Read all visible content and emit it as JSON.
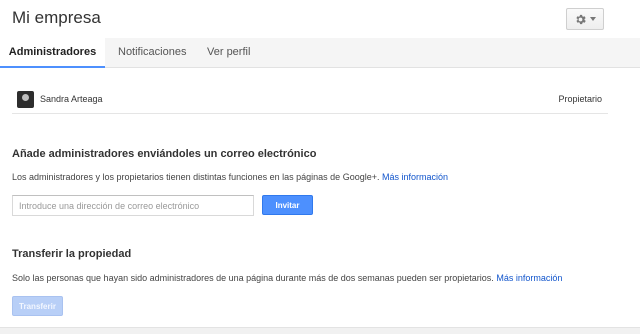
{
  "header": {
    "title": "Mi empresa",
    "settings_icon": "gear-icon",
    "dropdown_icon": "caret-down-icon"
  },
  "tabs": [
    {
      "label": "Administradores",
      "active": true
    },
    {
      "label": "Notificaciones",
      "active": false
    },
    {
      "label": "Ver perfil",
      "active": false
    }
  ],
  "owner": {
    "name": "Sandra Arteaga",
    "role": "Propietario",
    "avatar_icon": "avatar-photo"
  },
  "add_admins": {
    "title": "Añade administradores enviándoles un correo electrónico",
    "description": "Los administradores y los propietarios tienen distintas funciones en las páginas de Google+.",
    "link": "Más información",
    "email_placeholder": "Introduce una dirección de correo electrónico",
    "email_value": "",
    "invite_label": "Invitar"
  },
  "transfer": {
    "title": "Transferir la propiedad",
    "description": "Solo las personas que hayan sido administradores de una página durante más de dos semanas pueden ser propietarios.",
    "link": "Más información",
    "button_label": "Transferir"
  },
  "colors": {
    "accent": "#4d90fe",
    "link": "#1155cc",
    "disabled_button": "#b8cff7"
  }
}
